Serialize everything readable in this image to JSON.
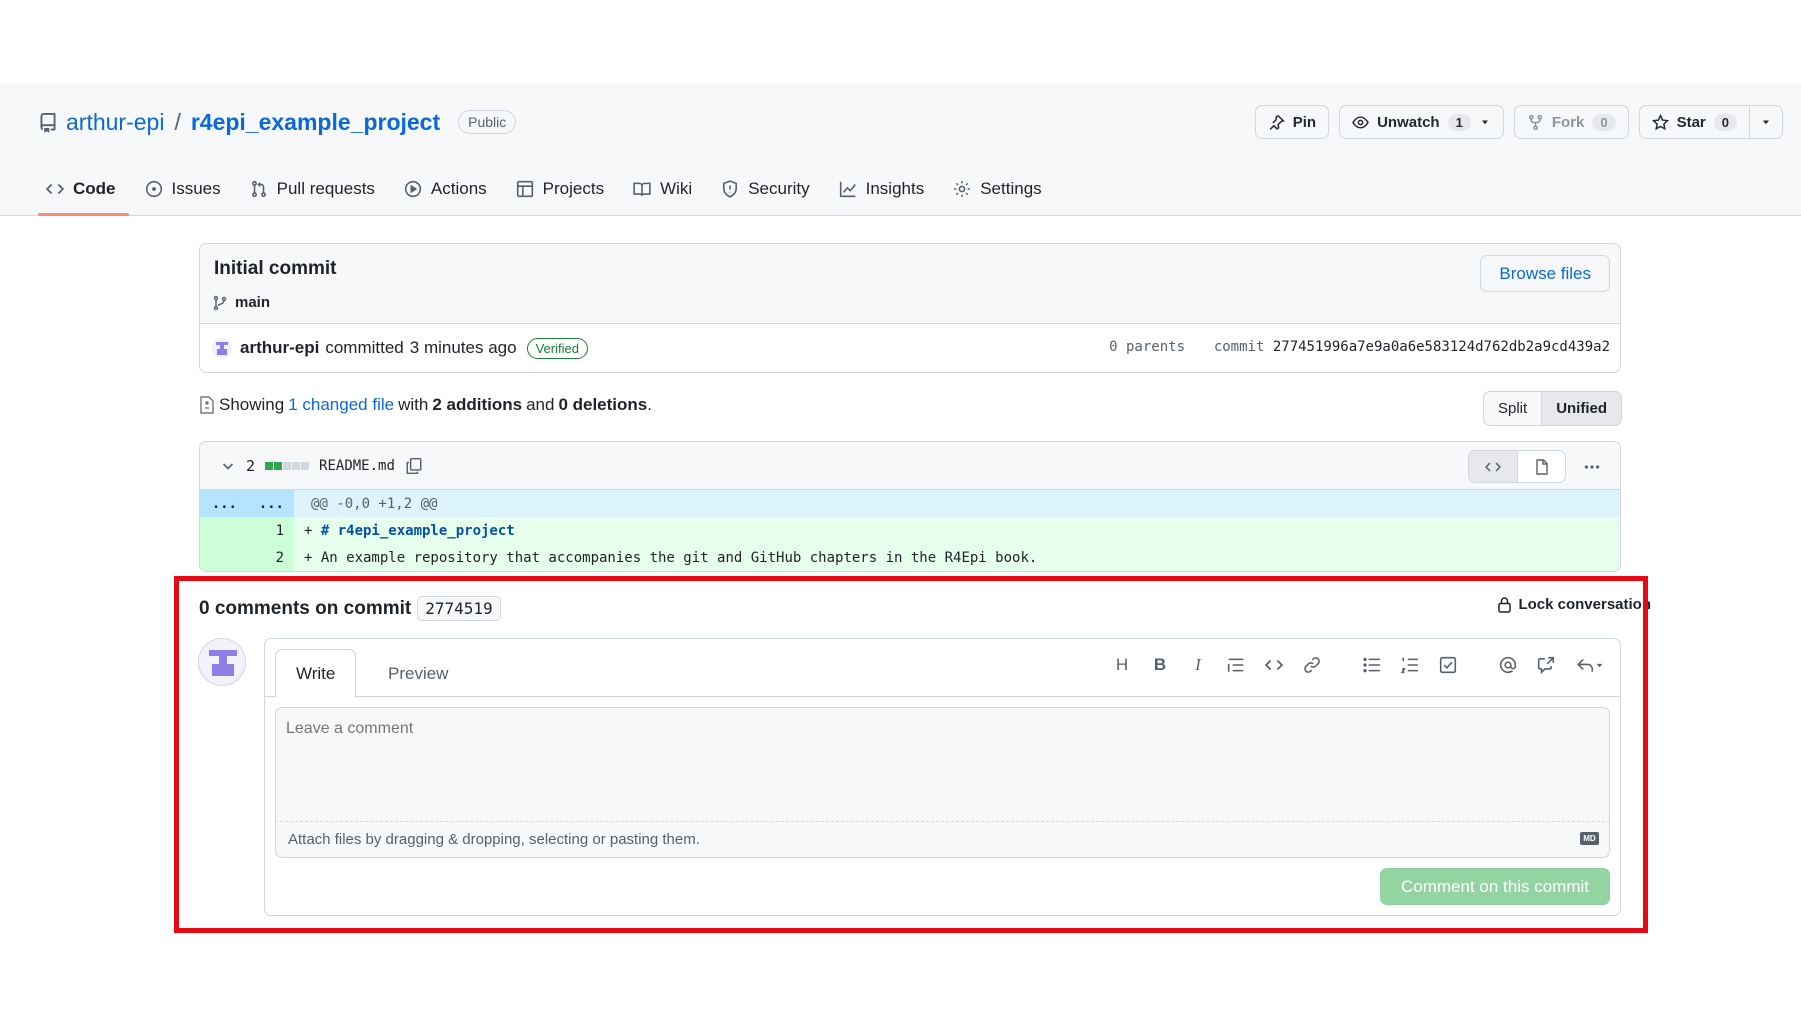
{
  "repo": {
    "owner": "arthur-epi",
    "separator": "/",
    "name": "r4epi_example_project",
    "visibility": "Public",
    "actions": {
      "pin": "Pin",
      "unwatch": "Unwatch",
      "unwatch_count": "1",
      "fork": "Fork",
      "fork_count": "0",
      "star": "Star",
      "star_count": "0"
    },
    "nav": [
      {
        "label": "Code",
        "icon": "code-icon",
        "active": true
      },
      {
        "label": "Issues",
        "icon": "issue-icon"
      },
      {
        "label": "Pull requests",
        "icon": "pull-request-icon"
      },
      {
        "label": "Actions",
        "icon": "play-icon"
      },
      {
        "label": "Projects",
        "icon": "table-icon"
      },
      {
        "label": "Wiki",
        "icon": "book-icon"
      },
      {
        "label": "Security",
        "icon": "shield-icon"
      },
      {
        "label": "Insights",
        "icon": "graph-icon"
      },
      {
        "label": "Settings",
        "icon": "gear-icon"
      }
    ]
  },
  "commit": {
    "title": "Initial commit",
    "branch": "main",
    "browse_files": "Browse files",
    "author": "arthur-epi",
    "verb": "committed",
    "time": "3 minutes ago",
    "verified": "Verified",
    "parents": "0 parents",
    "sha_label": "commit",
    "sha": "277451996a7e9a0a6e583124d762db2a9cd439a2"
  },
  "summary": {
    "showing": "Showing",
    "changed": "1 changed file",
    "with": "with",
    "additions": "2 additions",
    "and": "and",
    "deletions": "0 deletions",
    "period": "."
  },
  "view_toggle": {
    "split": "Split",
    "unified": "Unified"
  },
  "diff": {
    "count": "2",
    "filename": "README.md",
    "hunk_left": "...",
    "hunk_right": "...",
    "hunk_header": "@@ -0,0 +1,2 @@",
    "lines": [
      {
        "num": "1",
        "prefix": "+ ",
        "text": "# r4epi_example_project"
      },
      {
        "num": "2",
        "prefix": "+ ",
        "text": "An example repository that accompanies the git and GitHub chapters in the R4Epi book."
      }
    ]
  },
  "comments": {
    "title": "0 comments on commit",
    "short_sha": "2774519",
    "lock": "Lock conversation",
    "tabs": {
      "write": "Write",
      "preview": "Preview"
    },
    "toolbar": {
      "heading": "H",
      "bold": "B",
      "italic": "I"
    },
    "placeholder": "Leave a comment",
    "attach": "Attach files by dragging & dropping, selecting or pasting them.",
    "md_badge": "MD",
    "submit": "Comment on this commit"
  },
  "colors": {
    "accent": "#0969da",
    "tab_underline": "#fd8c73",
    "highlight": "#e50914",
    "diff_add_bg": "#e6ffec",
    "hunk_bg": "#ddf4ff",
    "submit_disabled": "#94d3a2"
  }
}
